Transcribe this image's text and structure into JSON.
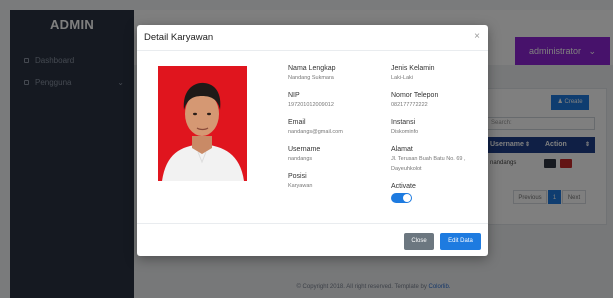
{
  "sidebar": {
    "brand": "ADMIN",
    "items": [
      {
        "label": "Dashboard"
      },
      {
        "label": "Pengguna"
      }
    ]
  },
  "header": {
    "user_label": "administrator",
    "user_chevron": "⌄"
  },
  "panel": {
    "create_label": "Create",
    "search_label": "Search:",
    "columns": [
      "Username",
      "Action"
    ],
    "rows": [
      {
        "username": "nandangs"
      }
    ],
    "pagination": {
      "previous": "Previous",
      "current": "1",
      "next": "Next"
    }
  },
  "footer": {
    "text": "© Copyright 2018. All right reserved. Template by ",
    "link": "Colorlib."
  },
  "modal": {
    "title": "Detail Karyawan",
    "close_glyph": "×",
    "fields": {
      "nama_label": "Nama Lengkap",
      "nama_value": "Nandang Sukmara",
      "nip_label": "NIP",
      "nip_value": "197201012009012",
      "email_label": "Email",
      "email_value": "nandangs@gmail.com",
      "username_label": "Username",
      "username_value": "nandangs",
      "posisi_label": "Posisi",
      "posisi_value": "Karyawan",
      "jk_label": "Jenis Kelamin",
      "jk_value": "Laki-Laki",
      "telp_label": "Nomor Telepon",
      "telp_value": "082177772222",
      "instansi_label": "Instansi",
      "instansi_value": "Diskominfo",
      "alamat_label": "Alamat",
      "alamat_value_1": "Jl. Terusan Buah Batu No. 69 ,",
      "alamat_value_2": "Dayeuhkolot",
      "activate_label": "Activate"
    },
    "activate_on": true,
    "buttons": {
      "close": "Close",
      "edit": "Edit Data"
    }
  },
  "colors": {
    "accent": "#1e7be0",
    "user_button": "#8e24d6",
    "photo_background": "#e0151e",
    "sidebar": "#2a3342"
  }
}
